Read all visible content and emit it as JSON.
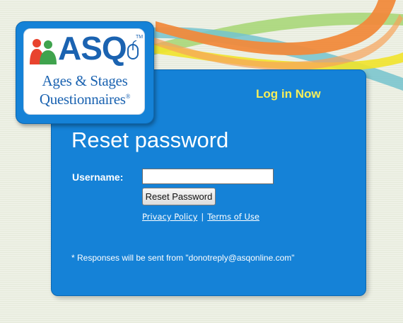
{
  "logo": {
    "mark": "ASQ",
    "trademark": "TM",
    "tagline_line1": "Ages & Stages",
    "tagline_line2": "Questionnaires",
    "registered": "®"
  },
  "header": {
    "login_link": "Log in Now"
  },
  "page": {
    "title": "Reset password"
  },
  "form": {
    "username_label": "Username:",
    "username_value": "",
    "reset_button": "Reset Password"
  },
  "footer_links": {
    "privacy": "Privacy Policy",
    "separator": "|",
    "terms": "Terms of Use"
  },
  "note": "* Responses will be sent from \"donotreply@asqonline.com\"",
  "colors": {
    "card_blue": "#1582d7",
    "link_yellow": "#f6ee5a",
    "brand_blue": "#1b63b1",
    "swoosh_orange": "#f2883f",
    "swoosh_yellow": "#f4e31f",
    "swoosh_green": "#9fd06a",
    "swoosh_teal": "#6ec0c8"
  }
}
